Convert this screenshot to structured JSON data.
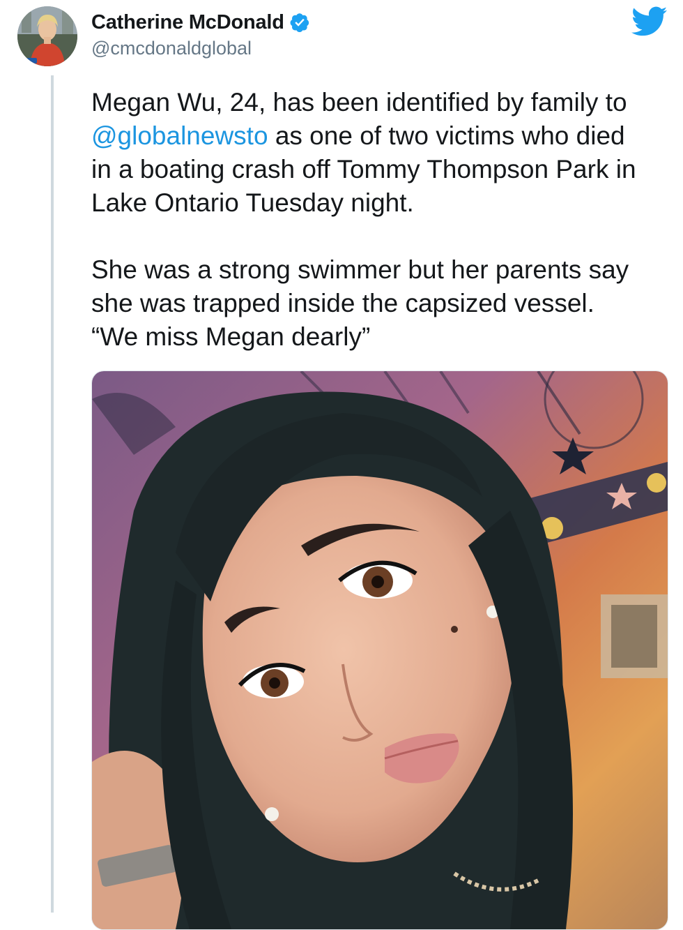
{
  "author": {
    "display_name": "Catherine McDonald",
    "handle": "@cmcdonaldglobal",
    "verified": true
  },
  "tweet": {
    "line1_part1": "Megan Wu, 24, has been identified by family to",
    "mention": "@globalnewsto",
    "line2_rest": " as one of two victims who died",
    "line3": "in a boating crash off Tommy Thompson Park in",
    "line4": "Lake Ontario Tuesday night.",
    "line5": "She was a strong swimmer but her parents say",
    "line6": "she was trapped inside the capsized vessel.",
    "line7": "“We miss Megan dearly”"
  },
  "icons": {
    "brand": "twitter-bird-icon",
    "verified": "verified-badge-icon"
  },
  "colors": {
    "brand_blue": "#1da1f2",
    "link_blue": "#1b95e0",
    "text": "#14171a",
    "secondary_text": "#657786",
    "thread_line": "#cfd9de"
  }
}
